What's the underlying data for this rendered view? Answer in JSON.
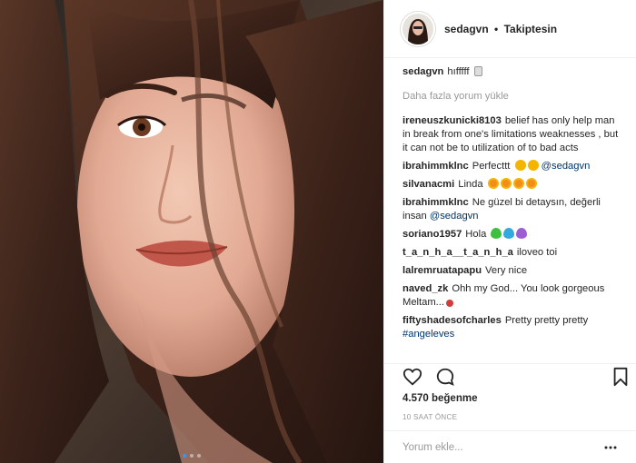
{
  "colors": {
    "link": "#003569",
    "muted": "#999999",
    "accent": "#3897f0",
    "border": "#efefef"
  },
  "header": {
    "username": "sedagvn",
    "separator": "•",
    "follow_status": "Takiptesin",
    "avatar_icon": "profile-avatar"
  },
  "caption": {
    "username": "sedagvn",
    "text": "hıfffff"
  },
  "load_more": "Daha fazla yorum yükle",
  "comments": [
    {
      "user": "ireneuszkunicki8103",
      "text": "belief has only help man in break from one's limitations weaknesses , but it can not be to utilization of to bad acts"
    },
    {
      "user": "ibrahimmklnc",
      "text": "Perfecttt",
      "mention": "@sedagvn"
    },
    {
      "user": "silvanacmi",
      "text": "Linda"
    },
    {
      "user": "ibrahimmklnc",
      "text": "Ne güzel bi detaysın, değerli insan",
      "mention": "@sedagvn"
    },
    {
      "user": "soriano1957",
      "text": "Hola"
    },
    {
      "user": "t_a_n_h_a__t_a_n_h_a",
      "text": "iloveo toi"
    },
    {
      "user": "lalremruatapapu",
      "text": "Very nice"
    },
    {
      "user": "naved_zk",
      "text": "Ohh my God... You look gorgeous Meltam..."
    },
    {
      "user": "fiftyshadesofcharles",
      "text": "Pretty pretty pretty",
      "mention": "#angeleves"
    }
  ],
  "actions": {
    "like_icon": "heart-icon",
    "comment_icon": "comment-icon",
    "save_icon": "bookmark-icon"
  },
  "likes": "4.570 beğenme",
  "timestamp": "10 SAAT ÖNCE",
  "comment_input": {
    "placeholder": "Yorum ekle...",
    "value": ""
  },
  "more_icon": "more-options-icon",
  "carousel": {
    "count": 3,
    "active_index": 0
  }
}
